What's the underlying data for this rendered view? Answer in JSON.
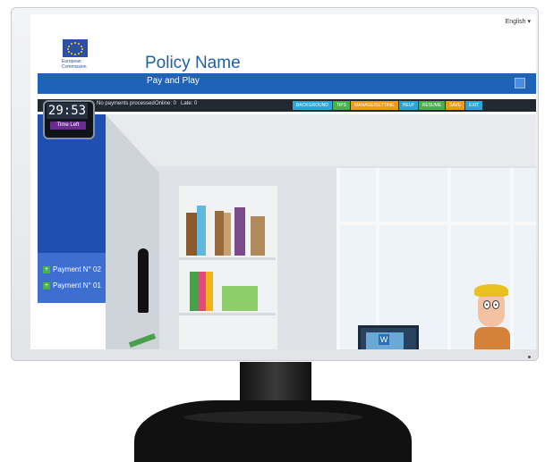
{
  "header": {
    "language": "English",
    "logo_text_line1": "European",
    "logo_text_line2": "Commission",
    "policy_name": "Policy Name",
    "subtitle": "Pay and Play"
  },
  "status_bar": {
    "no_payments": "No payments processed",
    "online": "Online: 0",
    "late": "Late: 0",
    "tabs": [
      {
        "label": "BACKGROUND",
        "color": "#2aa7d8"
      },
      {
        "label": "TIPS",
        "color": "#48b14c"
      },
      {
        "label": "MANAGE/SETTING",
        "color": "#f39a1a"
      },
      {
        "label": "HELP",
        "color": "#2aa7d8"
      },
      {
        "label": "RESUME",
        "color": "#48b14c"
      },
      {
        "label": "SAVE",
        "color": "#f39a1a"
      },
      {
        "label": "EXIT",
        "color": "#2aa7d8"
      }
    ]
  },
  "timer": {
    "value": "29:53",
    "label": "Time Left"
  },
  "sidebar": {
    "payments": [
      {
        "label": "Payment N° 02"
      },
      {
        "label": "Payment N° 01"
      }
    ]
  },
  "colors": {
    "brand_blue": "#1e63b8",
    "sidebar_blue": "#1f4fb0",
    "status_bg": "#22282f",
    "timer_label": "#6a2d8f"
  }
}
